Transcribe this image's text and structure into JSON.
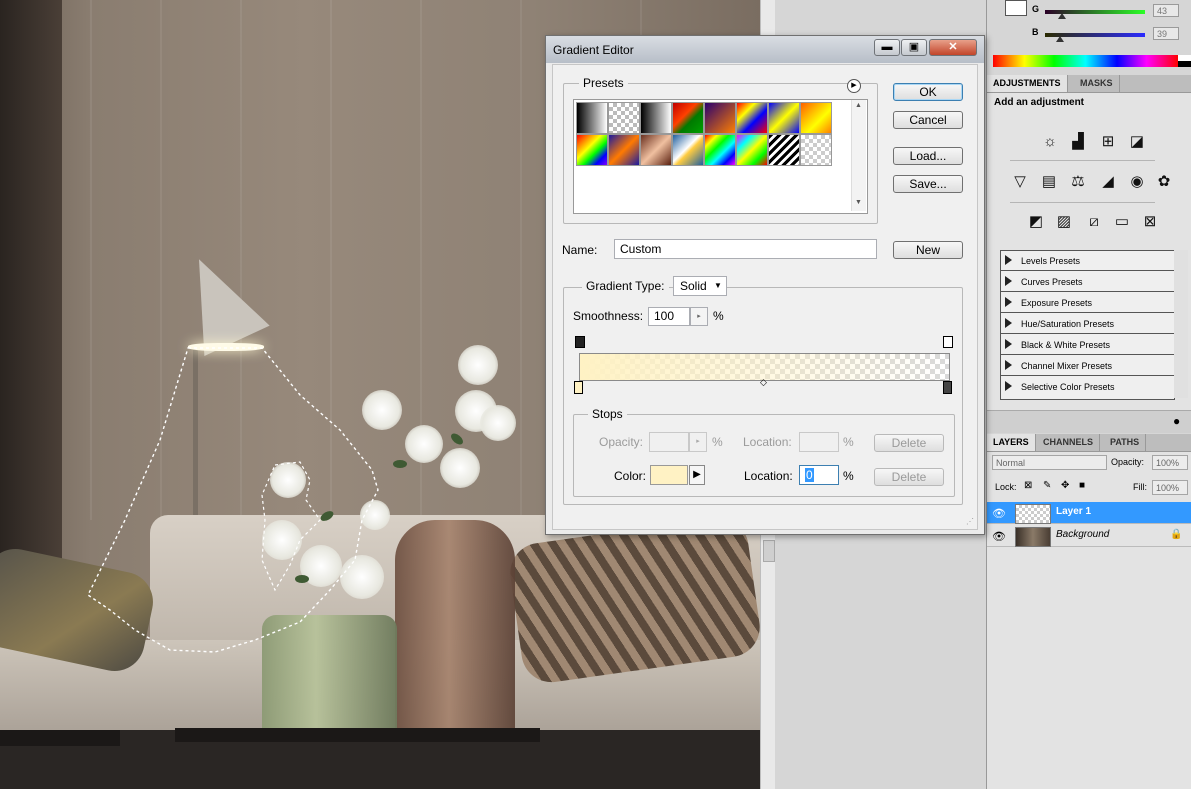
{
  "dialog": {
    "title": "Gradient Editor",
    "presets_label": "Presets",
    "buttons": {
      "ok": "OK",
      "cancel": "Cancel",
      "load": "Load...",
      "save": "Save...",
      "new": "New"
    },
    "name_label": "Name:",
    "name_value": "Custom",
    "gradient_type_label": "Gradient Type:",
    "gradient_type_value": "Solid",
    "smoothness_label": "Smoothness:",
    "smoothness_value": "100",
    "percent": "%",
    "stops": {
      "label": "Stops",
      "opacity_label": "Opacity:",
      "opacity_location_label": "Location:",
      "color_label": "Color:",
      "color_location_label": "Location:",
      "color_location_value": "0",
      "delete_label": "Delete",
      "color_swatch": "#fff2c4"
    },
    "gradient_start_color": "#fff2c4",
    "preset_swatches": [
      "linear-gradient(90deg,#000,#fff)",
      "repeating-conic-gradient(#bbb 0 25%,#fff 0 50%) 0 0/8px 8px",
      "linear-gradient(90deg,#000,#fff)",
      "linear-gradient(135deg,#c00000,#ff4000 40%,#007a00 60%,#00a000)",
      "linear-gradient(135deg,#2a0070,#ff8000)",
      "linear-gradient(135deg,#ff0000,#ffff00 30%,#0000ff 60%,#ff0000)",
      "linear-gradient(135deg,#0000ff,#ffff00 50%,#0000ff)",
      "linear-gradient(135deg,#ff6000,#ffff00 60%,#ff8000)",
      "linear-gradient(135deg,#ff0000,#ff8000,#ffff00,#00ff00,#0000ff,#8000ff)",
      "linear-gradient(135deg,#1a1aa0,#ff7a00 50%,#1a1aa0)",
      "linear-gradient(135deg,#6a3020,#f0c0a0 50%,#5a2010)",
      "linear-gradient(135deg,#2060a0,#ffffff 45%,#ffcc40 55%,#2060a0)",
      "linear-gradient(135deg,#ff0000,#ffff00,#00ff00,#00ffff,#0000ff,#ff00ff)",
      "linear-gradient(135deg,#ff00ff,#00ffff,#ffff00,#00ff00,#ff0000)",
      "repeating-linear-gradient(135deg,#000 0 3px,#fff 3px 6px)",
      "repeating-conic-gradient(#ccc 0 25%,#fff 0 50%) 0 0/8px 8px"
    ]
  },
  "panels": {
    "color": {
      "g_label": "G",
      "g_value": "43",
      "b_label": "B",
      "b_value": "39"
    },
    "adjustments": {
      "tabs": [
        "ADJUSTMENTS",
        "MASKS"
      ],
      "subtitle": "Add an adjustment",
      "presets": [
        "Levels Presets",
        "Curves Presets",
        "Exposure Presets",
        "Hue/Saturation Presets",
        "Black & White Presets",
        "Channel Mixer Presets",
        "Selective Color Presets"
      ]
    },
    "layers": {
      "tabs": [
        "LAYERS",
        "CHANNELS",
        "PATHS"
      ],
      "blend_mode": "Normal",
      "opacity_label": "Opacity:",
      "opacity_value": "100%",
      "lock_label": "Lock:",
      "fill_label": "Fill:",
      "fill_value": "100%",
      "items": [
        {
          "name": "Layer 1",
          "selected": true
        },
        {
          "name": "Background",
          "selected": false
        }
      ]
    }
  }
}
